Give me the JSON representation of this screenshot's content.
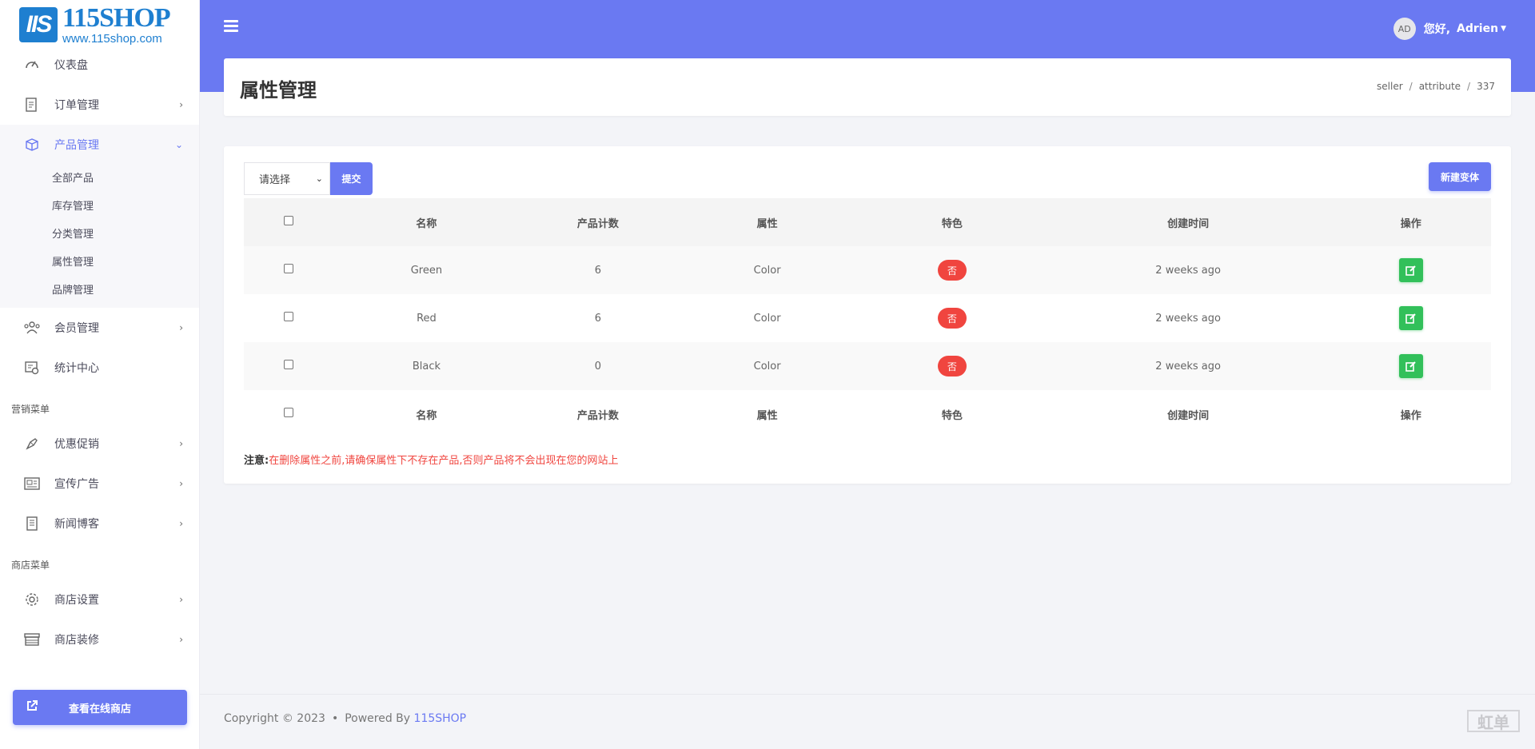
{
  "brand": {
    "logo_badge": "IIS",
    "logo_main": "115SHOP",
    "logo_sub": "www.115shop.com"
  },
  "sidebar": {
    "items_top": [
      {
        "label": "仪表盘",
        "icon": "dashboard-icon"
      },
      {
        "label": "订单管理",
        "icon": "orders-icon"
      },
      {
        "label": "产品管理",
        "icon": "products-icon"
      }
    ],
    "product_submenu": [
      "全部产品",
      "库存管理",
      "分类管理",
      "属性管理",
      "品牌管理"
    ],
    "items_mid": [
      {
        "label": "会员管理",
        "icon": "members-icon"
      },
      {
        "label": "统计中心",
        "icon": "statistics-icon"
      }
    ],
    "section_marketing": "营销菜单",
    "marketing_items": [
      {
        "label": "优惠促销",
        "icon": "promotion-icon"
      },
      {
        "label": "宣传广告",
        "icon": "ads-icon"
      },
      {
        "label": "新闻博客",
        "icon": "news-icon"
      }
    ],
    "section_shop": "商店菜单",
    "shop_items": [
      {
        "label": "商店设置",
        "icon": "settings-icon"
      },
      {
        "label": "商店装修",
        "icon": "store-icon"
      }
    ],
    "view_shop": "查看在线商店"
  },
  "topbar": {
    "avatar": "AD",
    "greeting": "您好,",
    "username": "Adrien"
  },
  "page": {
    "title": "属性管理",
    "breadcrumb": [
      "seller",
      "attribute",
      "337"
    ]
  },
  "toolbar": {
    "select_value": "请选择",
    "submit_label": "提交",
    "new_label": "新建变体"
  },
  "table": {
    "headers": [
      "名称",
      "产品计数",
      "属性",
      "特色",
      "创建时间",
      "操作"
    ],
    "rows": [
      {
        "name": "Green",
        "count": "6",
        "attr": "Color",
        "featured": "否",
        "created": "2 weeks ago"
      },
      {
        "name": "Red",
        "count": "6",
        "attr": "Color",
        "featured": "否",
        "created": "2 weeks ago"
      },
      {
        "name": "Black",
        "count": "0",
        "attr": "Color",
        "featured": "否",
        "created": "2 weeks ago"
      }
    ]
  },
  "note": {
    "label": "注意:",
    "text": "在删除属性之前,请确保属性下不存在产品,否则产品将不会出现在您的网站上"
  },
  "footer": {
    "copyright": "Copyright © 2023",
    "dot": "•",
    "powered": "Powered By",
    "brand": "115SHOP"
  },
  "colors": {
    "primary": "#6a79f2",
    "danger": "#f0453f",
    "success": "#32c05a"
  }
}
